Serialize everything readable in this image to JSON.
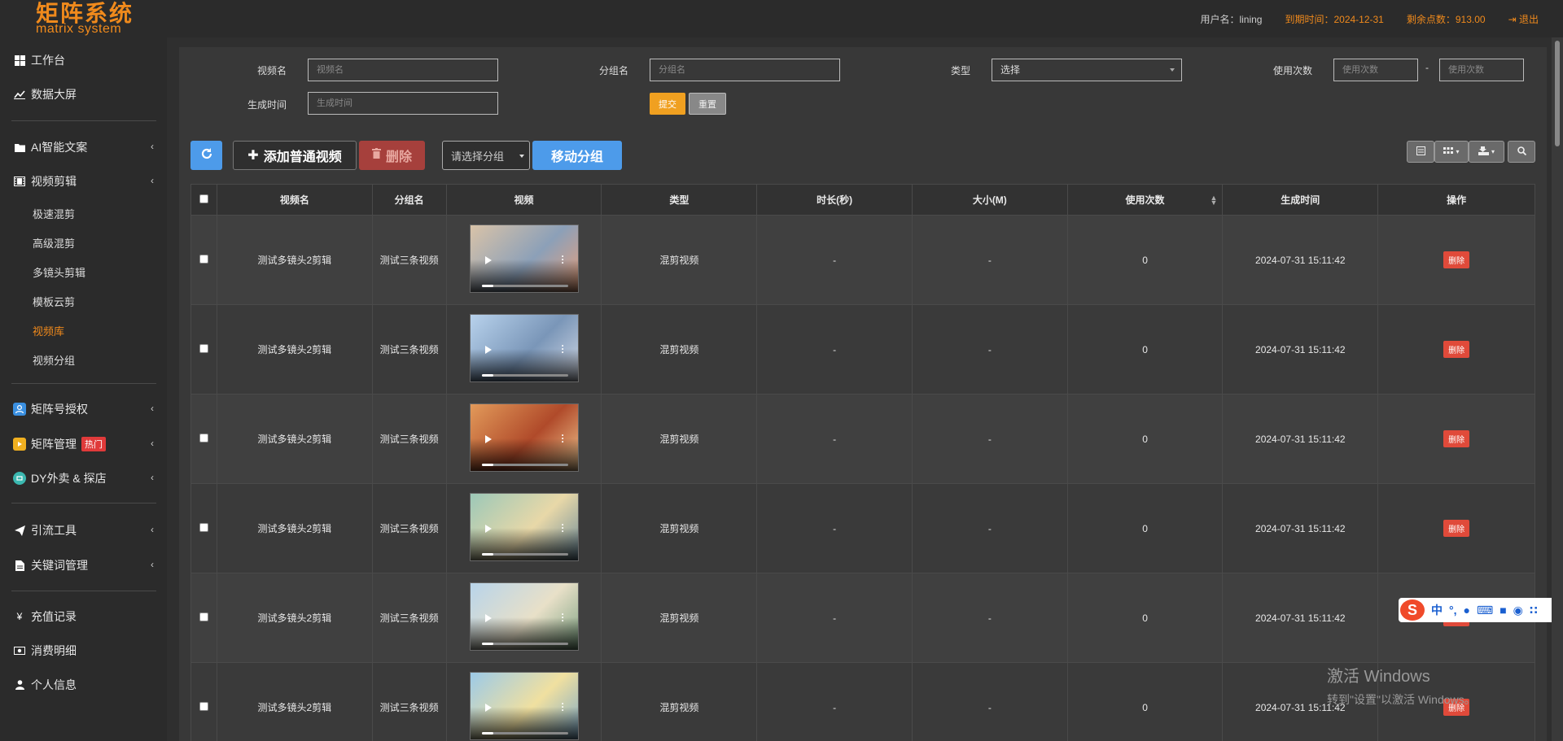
{
  "app": {
    "logo_cn": "矩阵系统",
    "logo_en": "matrix system",
    "username_label": "用户名：lining",
    "expire_label": "到期时间：2024-12-31",
    "points_label": "剩余点数：913.00",
    "logout_label": "退出"
  },
  "sidebar": {
    "items": [
      {
        "label": "工作台",
        "icon": "windows-icon"
      },
      {
        "label": "数据大屏",
        "icon": "chart-line-icon"
      },
      {
        "label": "AI智能文案",
        "icon": "folder-icon"
      },
      {
        "label": "视频剪辑",
        "icon": "film-icon"
      },
      {
        "label": "矩阵号授权",
        "icon": "account-icon"
      },
      {
        "label": "矩阵管理",
        "icon": "video-icon",
        "badge": "热门"
      },
      {
        "label": "DY外卖 & 探店",
        "icon": "store-icon"
      },
      {
        "label": "引流工具",
        "icon": "paper-plane-icon"
      },
      {
        "label": "关键词管理",
        "icon": "document-icon"
      },
      {
        "label": "充值记录",
        "icon": "yen-icon"
      },
      {
        "label": "消费明细",
        "icon": "money-icon"
      },
      {
        "label": "个人信息",
        "icon": "user-icon"
      }
    ],
    "sub_items": [
      "极速混剪",
      "高级混剪",
      "多镜头剪辑",
      "模板云剪",
      "视频库",
      "视频分组"
    ],
    "active_sub": "视频库"
  },
  "filters": {
    "video_name_label": "视频名",
    "video_name_placeholder": "视频名",
    "group_name_label": "分组名",
    "group_name_placeholder": "分组名",
    "type_label": "类型",
    "type_value": "选择",
    "usage_label": "使用次数",
    "usage_min_placeholder": "使用次数",
    "usage_sep": "-",
    "usage_max_placeholder": "使用次数",
    "created_label": "生成时间",
    "created_placeholder": "生成时间",
    "submit_label": "提交",
    "reset_label": "重置"
  },
  "toolbar": {
    "add_label": "添加普通视频",
    "delete_label": "删除",
    "group_select_label": "请选择分组",
    "move_label": "移动分组"
  },
  "table": {
    "headers": [
      "视频名",
      "分组名",
      "视频",
      "类型",
      "时长(秒)",
      "大小(M)",
      "使用次数",
      "生成时间",
      "操作"
    ],
    "rows": [
      {
        "name": "测试多镜头2剪辑",
        "group": "测试三条视频",
        "type": "混剪视频",
        "duration": "-",
        "size": "-",
        "usage": "0",
        "created": "2024-07-31 15:11:42",
        "action": "删除"
      },
      {
        "name": "测试多镜头2剪辑",
        "group": "测试三条视频",
        "type": "混剪视频",
        "duration": "-",
        "size": "-",
        "usage": "0",
        "created": "2024-07-31 15:11:42",
        "action": "删除"
      },
      {
        "name": "测试多镜头2剪辑",
        "group": "测试三条视频",
        "type": "混剪视频",
        "duration": "-",
        "size": "-",
        "usage": "0",
        "created": "2024-07-31 15:11:42",
        "action": "删除"
      },
      {
        "name": "测试多镜头2剪辑",
        "group": "测试三条视频",
        "type": "混剪视频",
        "duration": "-",
        "size": "-",
        "usage": "0",
        "created": "2024-07-31 15:11:42",
        "action": "删除"
      },
      {
        "name": "测试多镜头2剪辑",
        "group": "测试三条视频",
        "type": "混剪视频",
        "duration": "-",
        "size": "-",
        "usage": "0",
        "created": "2024-07-31 15:11:42",
        "action": "删除"
      },
      {
        "name": "测试多镜头2剪辑",
        "group": "测试三条视频",
        "type": "混剪视频",
        "duration": "-",
        "size": "-",
        "usage": "0",
        "created": "2024-07-31 15:11:42",
        "action": "删除"
      }
    ]
  },
  "ime": {
    "lang": "中",
    "logo": "S"
  },
  "watermark": {
    "line1": "激活 Windows",
    "line2": "转到\"设置\"以激活 Windows。"
  },
  "colors": {
    "accent": "#f08a1c",
    "primary": "#4d9bea",
    "danger": "#e04a3a"
  }
}
